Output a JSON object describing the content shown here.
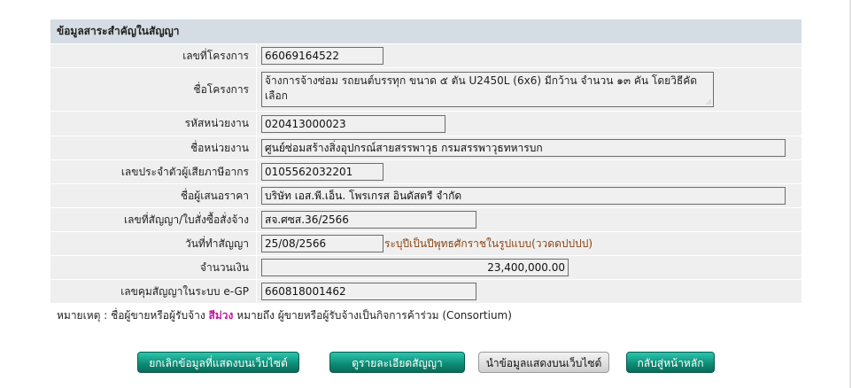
{
  "header": {
    "title": "ข้อมูลสาระสำคัญในสัญญา"
  },
  "fields": {
    "project_no": {
      "label": "เลขที่โครงการ",
      "value": "66069164522"
    },
    "project_name": {
      "label": "ชื่อโครงการ",
      "value": "จ้างการจ้างซ่อม รถยนต์บรรทุก ขนาด ๕ ตัน U2450L (6x6) มีกว้าน จำนวน ๑๓ คัน โดยวิธีคัดเลือก"
    },
    "dept_code": {
      "label": "รหัสหน่วยงาน",
      "value": "020413000023"
    },
    "dept_name": {
      "label": "ชื่อหน่วยงาน",
      "value": "ศูนย์ซ่อมสร้างสิ่งอุปกรณ์สายสรรพาวุธ กรมสรรพาวุธทหารบก"
    },
    "tax_id": {
      "label": "เลขประจำตัวผู้เสียภาษีอากร",
      "value": "0105562032201"
    },
    "bidder": {
      "label": "ชื่อผู้เสนอราคา",
      "value": "บริษัท เอส.พี.เอ็น. โพรเกรส อินดัสตรี จำกัด"
    },
    "contract_no": {
      "label": "เลขที่สัญญา/ใบสั่งซื้อสั่งจ้าง",
      "value": "สจ.ศซส.36/2566"
    },
    "contract_date": {
      "label": "วันที่ทำสัญญา",
      "value": "25/08/2566",
      "hint": "ระบุปีเป็นปีพุทธศักราชในรูปแบบ(ววดดปปปป)"
    },
    "amount": {
      "label": "จำนวนเงิน",
      "value": "23,400,000.00"
    },
    "egp_no": {
      "label": "เลขคุมสัญญาในระบบ e-GP",
      "value": "660818001462"
    }
  },
  "note": {
    "prefix": "หมายเหตุ : ชื่อผู้ขายหรือผู้รับจ้าง",
    "highlight": "สีม่วง",
    "suffix": "หมายถึง ผู้ขายหรือผู้รับจ้างเป็นกิจการค้าร่วม (Consortium)",
    "highlight_color": "#c0169a"
  },
  "buttons": {
    "cancel_publish": "ยกเลิกข้อมูลที่แสดงบนเว็บไซต์",
    "view_detail": "ดูรายละเอียดสัญญา",
    "publish": "นำข้อมูลแสดงบนเว็บไซต์",
    "home": "กลับสู่หน้าหลัก"
  }
}
